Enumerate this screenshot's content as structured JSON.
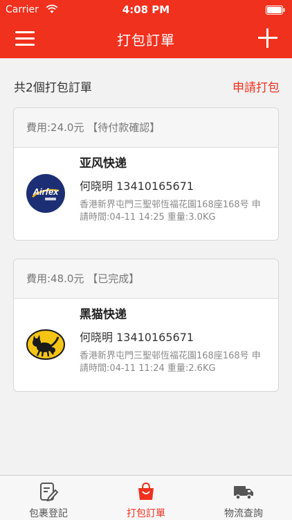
{
  "status_bar": {
    "carrier": "Carrier",
    "time": "4:08 PM"
  },
  "nav": {
    "title": "打包訂單"
  },
  "summary": {
    "count_text": "共2個打包訂單",
    "apply_label": "申請打包"
  },
  "orders": [
    {
      "fee_status": "費用:24.0元 【待付款確認】",
      "courier": "亚风快递",
      "recipient": "何晓明 13410165671",
      "address_detail": "香港新界屯門三聖邨恆福花園168座168号 申請時間:04-11 14:25 重量:3.0KG",
      "logo_icon": "airfex-logo",
      "logo_text": "Airfex"
    },
    {
      "fee_status": "費用:48.0元 【已完成】",
      "courier": "黑猫快递",
      "recipient": "何晓明 13410165671",
      "address_detail": "香港新界屯門三聖邨恆福花園168座168号 申請時間:04-11 11:24 重量:2.6KG",
      "logo_icon": "black-cat-logo"
    }
  ],
  "tabbar": {
    "tabs": [
      {
        "label": "包裹登記",
        "icon": "form-edit-icon",
        "active": false
      },
      {
        "label": "打包訂單",
        "icon": "shopping-bag-icon",
        "active": true
      },
      {
        "label": "物流查詢",
        "icon": "truck-icon",
        "active": false
      }
    ]
  },
  "colors": {
    "accent": "#f0311e",
    "background": "#f2f2f2"
  }
}
